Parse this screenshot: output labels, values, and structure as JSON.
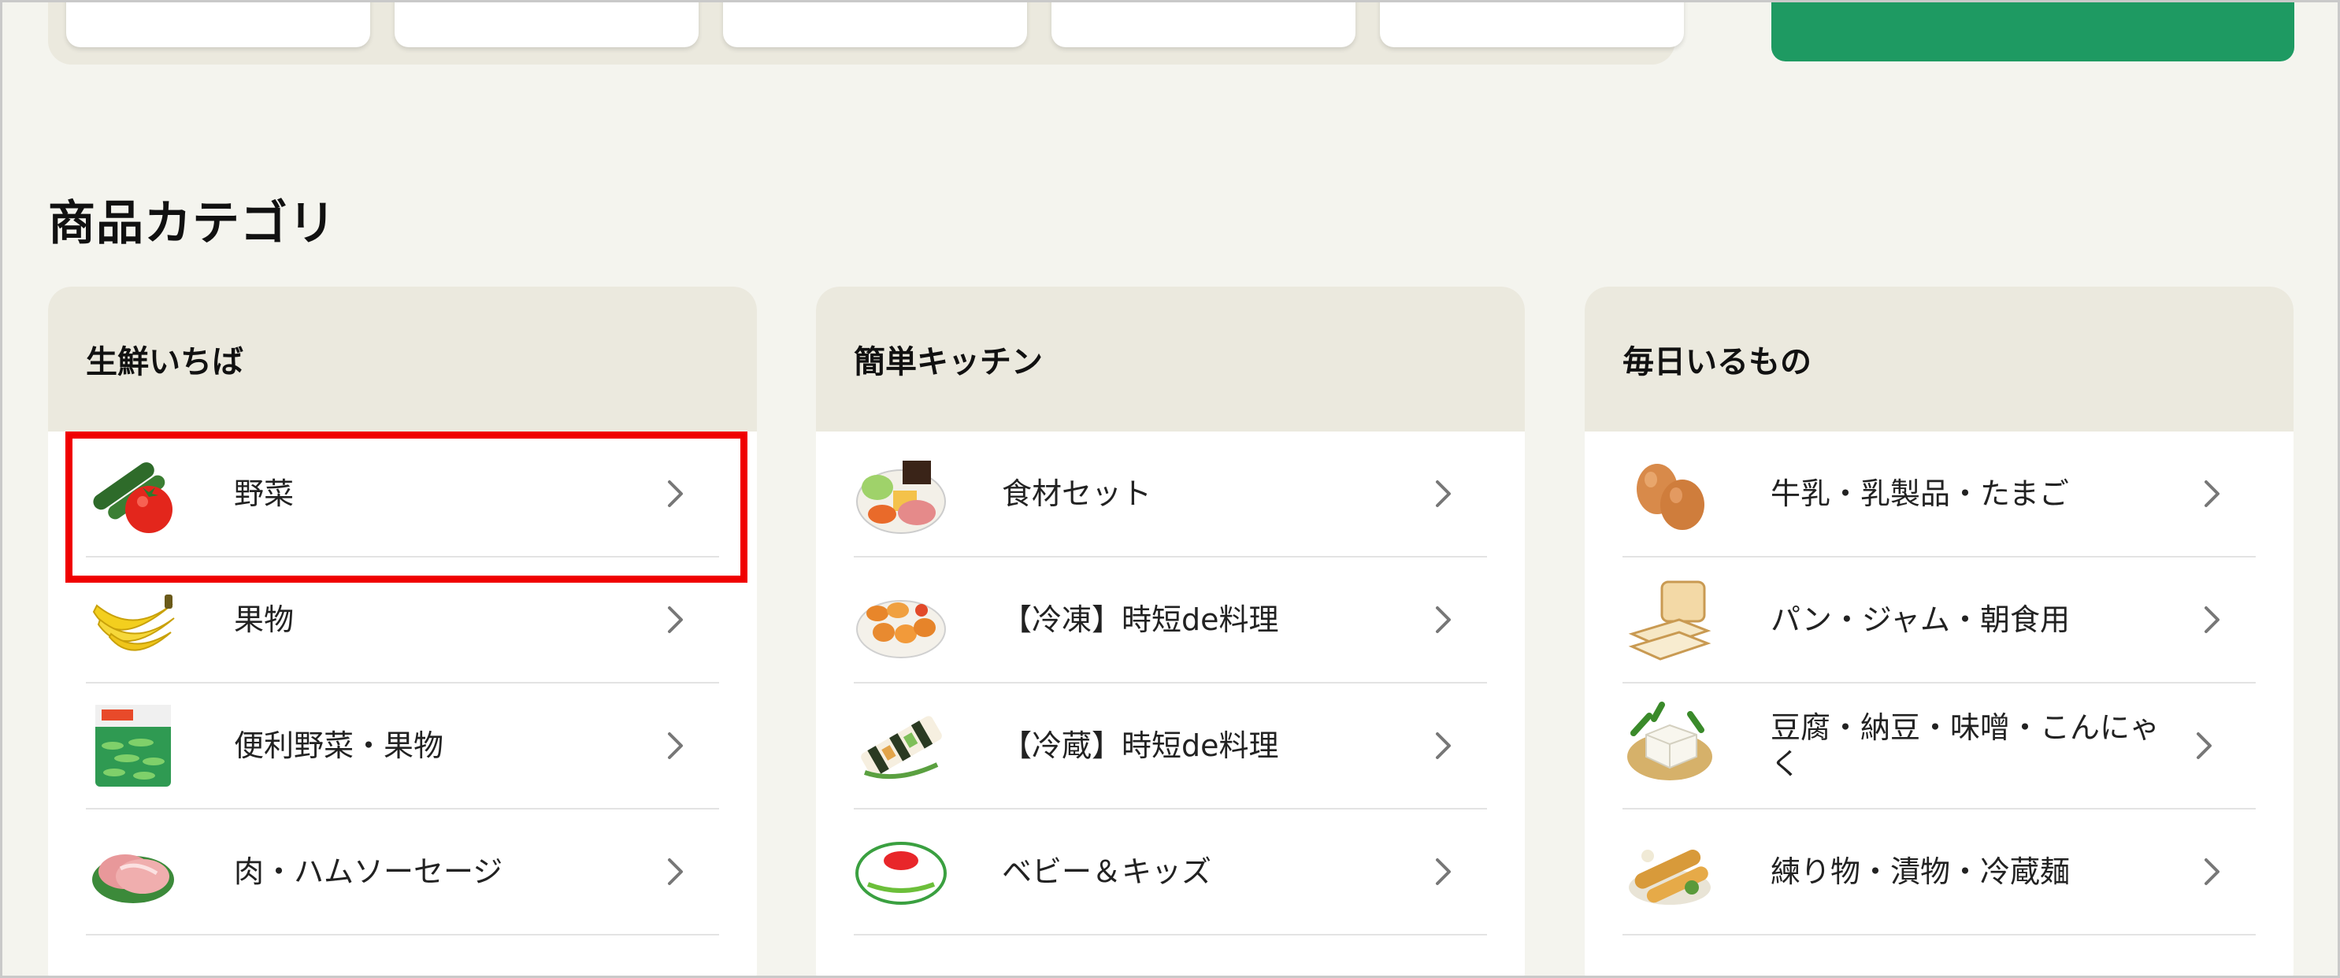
{
  "section": {
    "title": "商品カテゴリ"
  },
  "panels": [
    {
      "title": "生鮮いちば",
      "items": [
        {
          "label": "野菜",
          "icon": "vegetables-icon"
        },
        {
          "label": "果物",
          "icon": "banana-icon"
        },
        {
          "label": "便利野菜・果物",
          "icon": "frozen-beans-pack-icon"
        },
        {
          "label": "肉・ハムソーセージ",
          "icon": "meat-icon"
        }
      ]
    },
    {
      "title": "簡単キッチン",
      "items": [
        {
          "label": "食材セット",
          "icon": "meal-kit-icon"
        },
        {
          "label": "【冷凍】時短de料理",
          "icon": "fried-food-icon"
        },
        {
          "label": "【冷蔵】時短de料理",
          "icon": "sushi-roll-icon"
        },
        {
          "label": "ベビー＆キッズ",
          "icon": "coop-baby-logo-icon"
        }
      ]
    },
    {
      "title": "毎日いるもの",
      "items": [
        {
          "label": "牛乳・乳製品・たまご",
          "icon": "eggs-icon"
        },
        {
          "label": "パン・ジャム・朝食用",
          "icon": "bread-icon"
        },
        {
          "label": "豆腐・納豆・味噌・こんにゃく",
          "icon": "tofu-icon"
        },
        {
          "label": "練り物・漬物・冷蔵麺",
          "icon": "fish-cake-icon"
        }
      ]
    }
  ],
  "colors": {
    "background": "#f4f4ee",
    "panel_header": "#ebe9de",
    "banner_green": "#1e9a62",
    "highlight_red": "#f00000"
  }
}
